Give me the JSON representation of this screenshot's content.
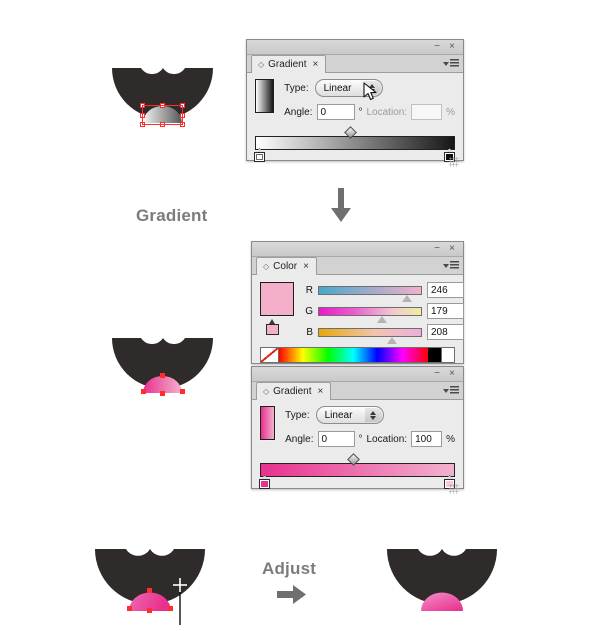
{
  "meta": {
    "accent_pink": "#ef4aa0",
    "dark_shape": "#2f2b2b",
    "caption_color": "#7c7c7c",
    "selection_color": "#ff2d2d"
  },
  "captions": {
    "gradient": "Gradient",
    "adjust": "Adjust"
  },
  "gradient_panel_top": {
    "tab_label": "Gradient",
    "tab_close": "×",
    "minimize": "−",
    "close": "×",
    "type_label": "Type:",
    "type_value": "Linear",
    "angle_label": "Angle:",
    "angle_value": "0",
    "degree_symbol": "°",
    "location_label": "Location:",
    "location_value": "",
    "percent_symbol": "%",
    "ramp_from": "#ffffff",
    "ramp_to": "#161616",
    "midpoint_percent": 50,
    "stop_left_color": "#ffffff",
    "stop_right_color": "#0d0d0d"
  },
  "color_panel": {
    "tab_label": "Color",
    "tab_close": "×",
    "minimize": "−",
    "close": "×",
    "fill_color": "#f4b0ca",
    "channels": [
      {
        "letter": "R",
        "value": "246",
        "from": "#4aa7c9",
        "to": "#f2b0cb",
        "thumb_percent": 88
      },
      {
        "letter": "G",
        "value": "179",
        "from": "#e919c9",
        "to": "#eeeea0",
        "thumb_percent": 63
      },
      {
        "letter": "B",
        "value": "208",
        "from": "#e8a712",
        "to": "#eeaedd",
        "thumb_percent": 72
      }
    ]
  },
  "gradient_panel_bottom": {
    "tab_label": "Gradient",
    "tab_close": "×",
    "minimize": "−",
    "close": "×",
    "type_label": "Type:",
    "type_value": "Linear",
    "angle_label": "Angle:",
    "angle_value": "0",
    "degree_symbol": "°",
    "location_label": "Location:",
    "location_value": "100",
    "percent_symbol": "%",
    "ramp_from": "#e8318e",
    "ramp_to": "#f3b2cf",
    "midpoint_percent": 50,
    "stop_left_color": "#e8318e",
    "stop_right_color": "#f7cada"
  },
  "artwork": {
    "shape_1": {
      "name": "mouth-with-gray-gradient-tongue",
      "tongue_from": "#f2f2f2",
      "tongue_to": "#5d5d5d",
      "selected": true
    },
    "shape_2": {
      "name": "mouth-with-pink-gradient-tongue",
      "tongue_from": "#e8318e",
      "tongue_to": "#f3b2cf",
      "selected": true
    },
    "shape_3": {
      "name": "mouth-with-pink-tongue-gradient-tool",
      "tongue_from": "#f06ab0",
      "tongue_to": "#e8318e",
      "selected": true
    },
    "shape_4": {
      "name": "mouth-final-result",
      "tongue_from": "#f083c0",
      "tongue_to": "#ea3d95",
      "selected": false
    }
  }
}
